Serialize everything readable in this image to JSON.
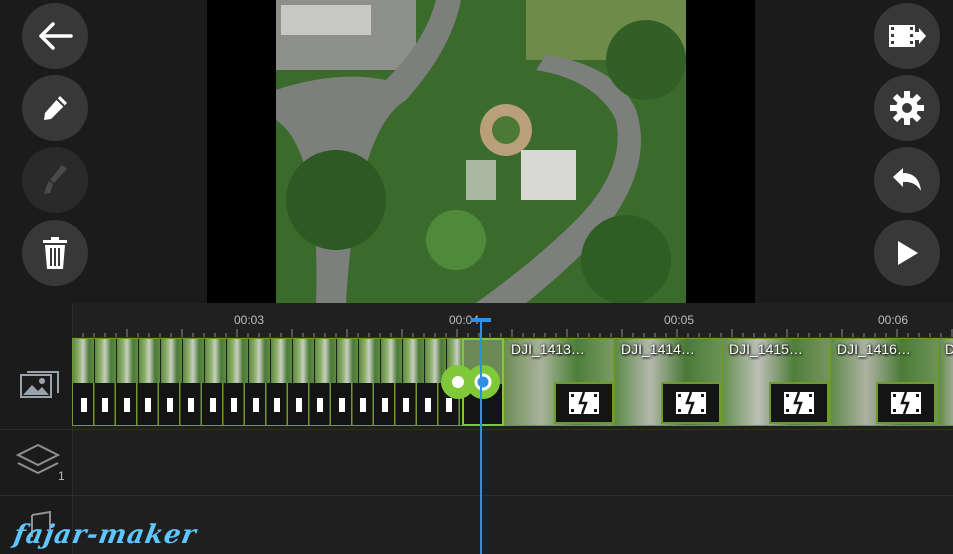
{
  "toolbar_left": {
    "back": "back-arrow-icon",
    "edit": "pencil-icon",
    "effect": "brush-icon",
    "delete": "trash-icon"
  },
  "toolbar_right": {
    "export": "film-export-icon",
    "settings": "gear-icon",
    "undo": "undo-icon",
    "play": "play-icon"
  },
  "ruler": {
    "ticks": [
      "00:03",
      "00:04",
      "00:05",
      "00:06"
    ]
  },
  "clips": [
    {
      "title": "DJI_1413…"
    },
    {
      "title": "DJI_1414…"
    },
    {
      "title": "DJI_1415…"
    },
    {
      "title": "DJI_1416…"
    },
    {
      "title": "DJI_"
    }
  ],
  "layer_track": {
    "count": "1"
  },
  "watermark": "fajar-maker",
  "colors": {
    "accent": "#6f9a2b",
    "playhead": "#2d8fe6",
    "handle": "#7ec83a"
  }
}
